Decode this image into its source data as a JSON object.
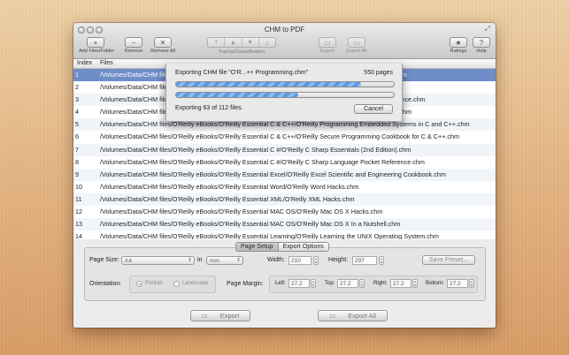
{
  "window": {
    "title": "CHM to PDF"
  },
  "toolbar": {
    "add": {
      "label": "Add Files/Folder",
      "icon": "plus-icon"
    },
    "remove": {
      "label": "Remove",
      "icon": "minus-icon"
    },
    "remove_all": {
      "label": "Remove All",
      "icon": "x-icon"
    },
    "nav_label": "Top/Up/Down/Bottom",
    "export": {
      "label": "Export",
      "icon": "export-icon"
    },
    "export_all": {
      "label": "Export All",
      "icon": "export-all-icon"
    },
    "ratings": {
      "label": "Ratings",
      "icon": "star-icon"
    },
    "help": {
      "label": "Help",
      "icon": "question-icon"
    }
  },
  "list": {
    "columns": [
      "Index",
      "Files"
    ],
    "rows": [
      {
        "index": "1",
        "file": "/Volumes/Data/CHM files/O'Reilly eBooks/O'Reilly Essential C & C++/O'Reilly C++ Cookbook Reference.chm",
        "selected": true
      },
      {
        "index": "2",
        "file": "/Volumes/Data/CHM files/O'Reilly eBooks/O'Reilly Essential C & C++/O'Reilly C++ Pocket Reference.chm",
        "selected": false
      },
      {
        "index": "3",
        "file": "/Volumes/Data/CHM files/O'Reilly eBooks/O'Reilly Essential C & C++/O'Reilly C++ Standard Library Reference.chm",
        "selected": false
      },
      {
        "index": "4",
        "file": "/Volumes/Data/CHM files/O'Reilly eBooks/O'Reilly Essential C & C++/O'Reilly Practical C++ Programming.chm",
        "selected": false
      },
      {
        "index": "5",
        "file": "/Volumes/Data/CHM files/O'Reilly eBooks/O'Reilly Essential C & C++/O'Reilly Programming Embedded Systems in C and C++.chm",
        "selected": false
      },
      {
        "index": "6",
        "file": "/Volumes/Data/CHM files/O'Reilly eBooks/O'Reilly Essential C & C++/O'Reilly Secure Programming Cookbook for C & C++.chm",
        "selected": false
      },
      {
        "index": "7",
        "file": "/Volumes/Data/CHM files/O'Reilly eBooks/O'Reilly Essential C #/O'Reilly C Sharp Essentials (2nd Edition).chm",
        "selected": false
      },
      {
        "index": "8",
        "file": "/Volumes/Data/CHM files/O'Reilly eBooks/O'Reilly Essential C #/O'Reilly C Sharp Language Pocket Reference.chm",
        "selected": false
      },
      {
        "index": "9",
        "file": "/Volumes/Data/CHM files/O'Reilly eBooks/O'Reilly Essential Excel/O'Reilly Excel Scientific and Engineering Cookbook.chm",
        "selected": false
      },
      {
        "index": "10",
        "file": "/Volumes/Data/CHM files/O'Reilly eBooks/O'Reilly Essential Word/O'Reilly Word Hacks.chm",
        "selected": false
      },
      {
        "index": "11",
        "file": "/Volumes/Data/CHM files/O'Reilly eBooks/O'Reilly Essential XML/O'Reilly XML Hacks.chm",
        "selected": false
      },
      {
        "index": "12",
        "file": "/Volumes/Data/CHM files/O'Reilly eBooks/O'Reilly Essential MAC OS/O'Reilly Mac OS X Hacks.chm",
        "selected": false
      },
      {
        "index": "13",
        "file": "/Volumes/Data/CHM files/O'Reilly eBooks/O'Reilly Essential MAC OS/O'Reilly Mac OS X In a Nutshell.chm",
        "selected": false
      },
      {
        "index": "14",
        "file": "/Volumes/Data/CHM files/O'Reilly eBooks/O'Reilly Essential Learning/O'Reilly Learning the UNIX Operating System.chm",
        "selected": false
      }
    ]
  },
  "progress": {
    "message": "Exporting CHM file \"O'R...++ Programming.chm\"",
    "pages": "550 pages",
    "file_progress": 0.85,
    "total_progress": 0.56,
    "status": "Exporting 63 of 112 files.",
    "cancel_label": "Cancel"
  },
  "settings": {
    "tabs": [
      {
        "label": "Page Setup",
        "active": true
      },
      {
        "label": "Export Options",
        "active": false
      }
    ],
    "page_size_label": "Page Size:",
    "page_size_value": "A4",
    "in_label": "in",
    "unit_value": "mm",
    "width_label": "Width:",
    "width_value": "210",
    "height_label": "Height:",
    "height_value": "297",
    "save_preset_label": "Save Preset...",
    "orientation_label": "Orientation:",
    "portrait_label": "Portrait",
    "landscape_label": "Landscape",
    "orientation_value": "Portrait",
    "margin_label": "Page Margin:",
    "margins": [
      {
        "label": "Left:",
        "value": "27.2"
      },
      {
        "label": "Top:",
        "value": "27.2"
      },
      {
        "label": "Right:",
        "value": "27.2"
      },
      {
        "label": "Bottom:",
        "value": "27.2"
      }
    ]
  },
  "bottom": {
    "export_label": "Export",
    "export_all_label": "Export All"
  }
}
